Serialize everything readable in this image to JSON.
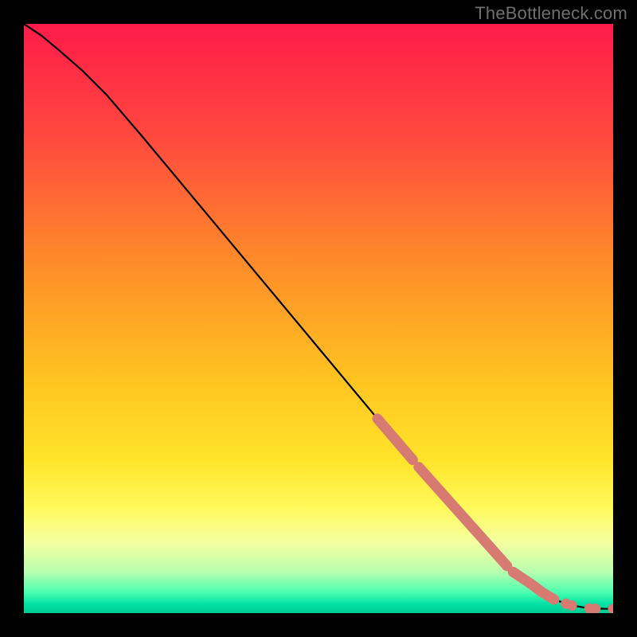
{
  "attribution": "TheBottleneck.com",
  "chart_data": {
    "type": "line",
    "title": "",
    "xlabel": "",
    "ylabel": "",
    "xlim": [
      0,
      100
    ],
    "ylim": [
      0,
      100
    ],
    "background_gradient_stops": [
      {
        "offset": 0.0,
        "color": "#ff1b4a"
      },
      {
        "offset": 0.2,
        "color": "#ff4b3e"
      },
      {
        "offset": 0.4,
        "color": "#ff8a2a"
      },
      {
        "offset": 0.6,
        "color": "#ffc321"
      },
      {
        "offset": 0.74,
        "color": "#ffe42a"
      },
      {
        "offset": 0.82,
        "color": "#fff95a"
      },
      {
        "offset": 0.88,
        "color": "#f5ffa0"
      },
      {
        "offset": 0.93,
        "color": "#b8ffb0"
      },
      {
        "offset": 0.965,
        "color": "#4bffb0"
      },
      {
        "offset": 0.985,
        "color": "#00e0a5"
      },
      {
        "offset": 1.0,
        "color": "#00cc92"
      }
    ],
    "curve": {
      "x": [
        0,
        3,
        6,
        10,
        14,
        20,
        30,
        40,
        50,
        60,
        66,
        70,
        74,
        78,
        82,
        86,
        88,
        90,
        93,
        96,
        100
      ],
      "y": [
        100,
        98,
        95.5,
        92,
        88,
        81,
        69,
        57,
        45,
        33,
        26,
        21,
        16.5,
        12,
        8,
        5,
        3.5,
        2.3,
        1.3,
        0.8,
        0.7
      ]
    },
    "highlight_segments": [
      {
        "x": [
          60,
          66
        ],
        "y": [
          33,
          26
        ]
      },
      {
        "x": [
          67,
          82
        ],
        "y": [
          24.8,
          8
        ]
      },
      {
        "x": [
          83,
          86
        ],
        "y": [
          7,
          5
        ]
      },
      {
        "x": [
          86,
          88
        ],
        "y": [
          5,
          3.5
        ]
      },
      {
        "x": [
          88,
          90
        ],
        "y": [
          3.5,
          2.3
        ]
      }
    ],
    "highlight_dots": [
      {
        "x": 92,
        "y": 1.6
      },
      {
        "x": 93,
        "y": 1.3
      },
      {
        "x": 96,
        "y": 0.8
      },
      {
        "x": 97,
        "y": 0.75
      },
      {
        "x": 100,
        "y": 0.7
      }
    ],
    "highlight_color": "#d77b72",
    "curve_color": "#000000"
  }
}
